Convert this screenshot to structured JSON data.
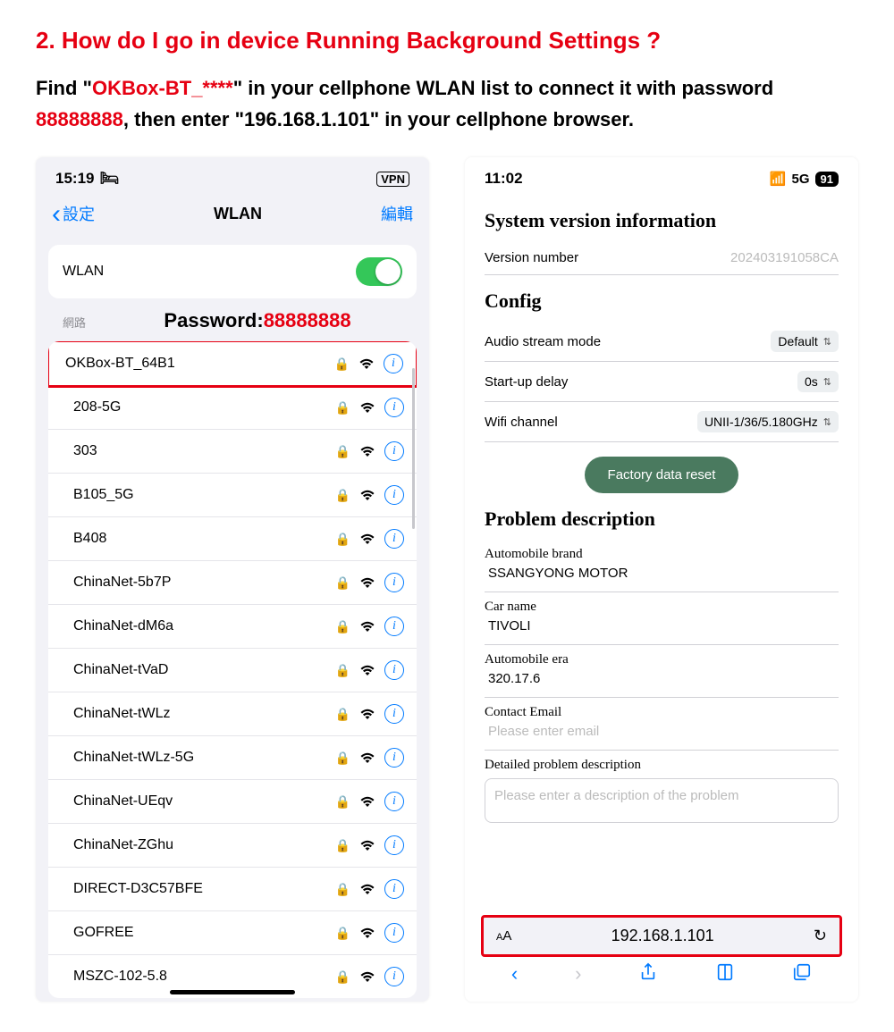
{
  "heading": "2. How do I go in device Running Background Settings ?",
  "instruction": {
    "prefix": "Find \"",
    "ssid": "OKBox-BT_****",
    "mid": "\" in your cellphone WLAN list to connect it with password ",
    "password": "88888888",
    "suffix": ", then enter   \"196.168.1.101\"   in your cellphone browser."
  },
  "phone1": {
    "time": "15:19",
    "vpn": "VPN",
    "nav_back": "設定",
    "nav_title": "WLAN",
    "nav_edit": "編輯",
    "wlan_label": "WLAN",
    "section_label": "網路",
    "password_callout_label": "Password:",
    "password_callout_value": "88888888",
    "networks": [
      "OKBox-BT_64B1",
      "208-5G",
      "303",
      "B105_5G",
      "B408",
      "ChinaNet-5b7P",
      "ChinaNet-dM6a",
      "ChinaNet-tVaD",
      "ChinaNet-tWLz",
      "ChinaNet-tWLz-5G",
      "ChinaNet-UEqv",
      "ChinaNet-ZGhu",
      "DIRECT-D3C57BFE",
      "GOFREE",
      "MSZC-102-5.8"
    ]
  },
  "phone2": {
    "time": "11:02",
    "signal": "5G",
    "battery": "91",
    "sys_info_heading": "System version information",
    "version_label": "Version number",
    "version_value": "202403191058CA",
    "config_heading": "Config",
    "audio_label": "Audio stream mode",
    "audio_value": "Default",
    "delay_label": "Start-up delay",
    "delay_value": "0s",
    "wifi_channel_label": "Wifi channel",
    "wifi_channel_value": "UNII-1/36/5.180GHz",
    "reset_button": "Factory data reset",
    "problem_heading": "Problem description",
    "brand_label": "Automobile brand",
    "brand_value": "SSANGYONG MOTOR",
    "car_label": "Car name",
    "car_value": "TIVOLI",
    "era_label": "Automobile era",
    "era_value": "320.17.6",
    "email_label": "Contact Email",
    "email_placeholder": "Please enter email",
    "desc_label": "Detailed problem description",
    "desc_placeholder": "Please enter a description of the problem",
    "url": "192.168.1.101"
  }
}
